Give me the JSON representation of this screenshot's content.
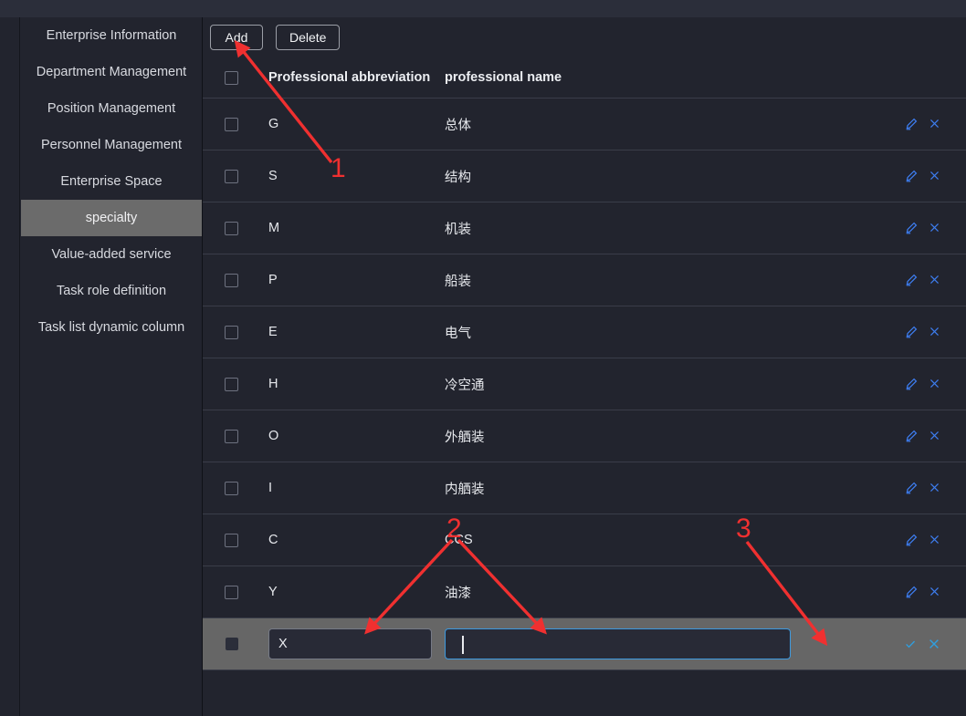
{
  "sidebar": {
    "items": [
      {
        "label": "Enterprise Information",
        "active": false
      },
      {
        "label": "Department Management",
        "active": false
      },
      {
        "label": "Position Management",
        "active": false
      },
      {
        "label": "Personnel Management",
        "active": false
      },
      {
        "label": "Enterprise Space",
        "active": false
      },
      {
        "label": "specialty",
        "active": true
      },
      {
        "label": "Value-added service",
        "active": false
      },
      {
        "label": "Task role definition",
        "active": false
      },
      {
        "label": "Task list dynamic column",
        "active": false
      }
    ]
  },
  "toolbar": {
    "add_label": "Add",
    "delete_label": "Delete"
  },
  "table": {
    "columns": {
      "abbreviation": "Professional abbreviation",
      "name": "professional name"
    },
    "rows": [
      {
        "abbr": "G",
        "name": "总体"
      },
      {
        "abbr": "S",
        "name": "结构"
      },
      {
        "abbr": "M",
        "name": "机装"
      },
      {
        "abbr": "P",
        "name": "船装"
      },
      {
        "abbr": "E",
        "name": "电气"
      },
      {
        "abbr": "H",
        "name": "冷空通"
      },
      {
        "abbr": "O",
        "name": "外舾装"
      },
      {
        "abbr": "I",
        "name": "内舾装"
      },
      {
        "abbr": "C",
        "name": "CCS"
      },
      {
        "abbr": "Y",
        "name": "油漆"
      }
    ],
    "edit_row": {
      "abbr_value": "X",
      "name_value": "",
      "abbr_placeholder": "",
      "name_placeholder": ""
    },
    "icons": {
      "edit": "pencil-icon",
      "delete": "close-icon",
      "confirm": "check-icon",
      "cancel": "close-icon"
    }
  },
  "annotations": [
    {
      "label": "1"
    },
    {
      "label": "2"
    },
    {
      "label": "3"
    }
  ],
  "colors": {
    "background": "#22242e",
    "sidebar_active": "#6b6b6b",
    "edit_row": "#666666",
    "action_blue": "#3d7df0",
    "focus_border": "#3d9ae0",
    "annotation_red": "#f03030"
  }
}
